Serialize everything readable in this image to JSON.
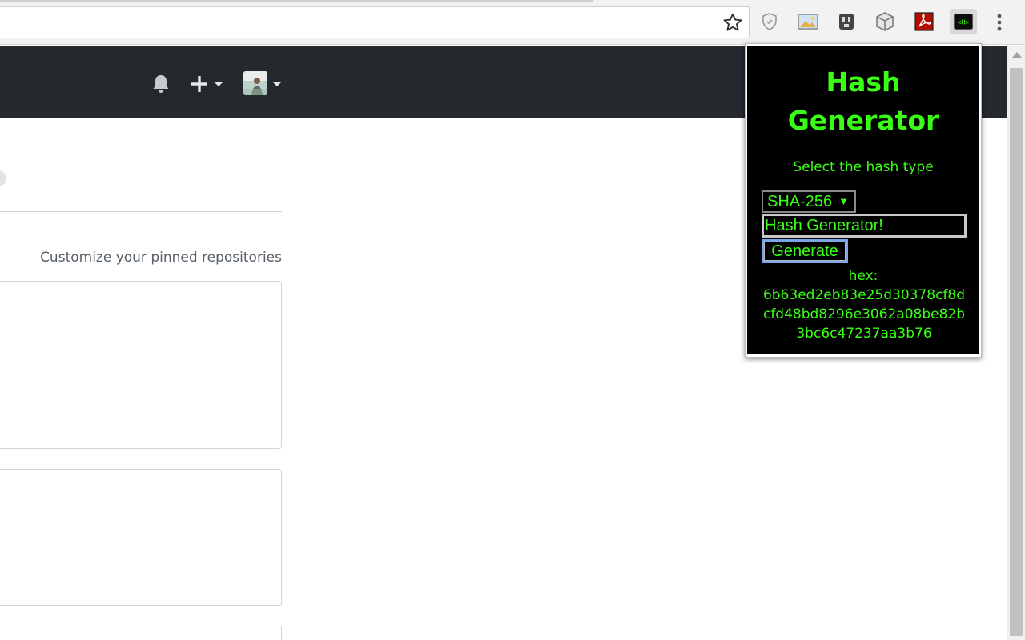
{
  "browser": {
    "extensions": [
      {
        "name": "shield-extension"
      },
      {
        "name": "image-extension"
      },
      {
        "name": "plug-extension"
      },
      {
        "name": "cube-extension"
      },
      {
        "name": "pdf-extension"
      },
      {
        "name": "hash-generator-extension",
        "label": "<H>",
        "active": true
      }
    ]
  },
  "page": {
    "customize_link": "Customize your pinned repositories"
  },
  "popup": {
    "title": "Hash Generator",
    "subtitle": "Select the hash type",
    "hash_type": "SHA-256",
    "input_value": "Hash Generator!",
    "generate_label": "Generate",
    "output_label": "hex:",
    "output_value": "6b63ed2eb83e25d30378cf8dcfd48bd8296e3062a08be82b3bc6c47237aa3b76"
  },
  "colors": {
    "accent": "#39ff14",
    "header_bg": "#24292e"
  }
}
